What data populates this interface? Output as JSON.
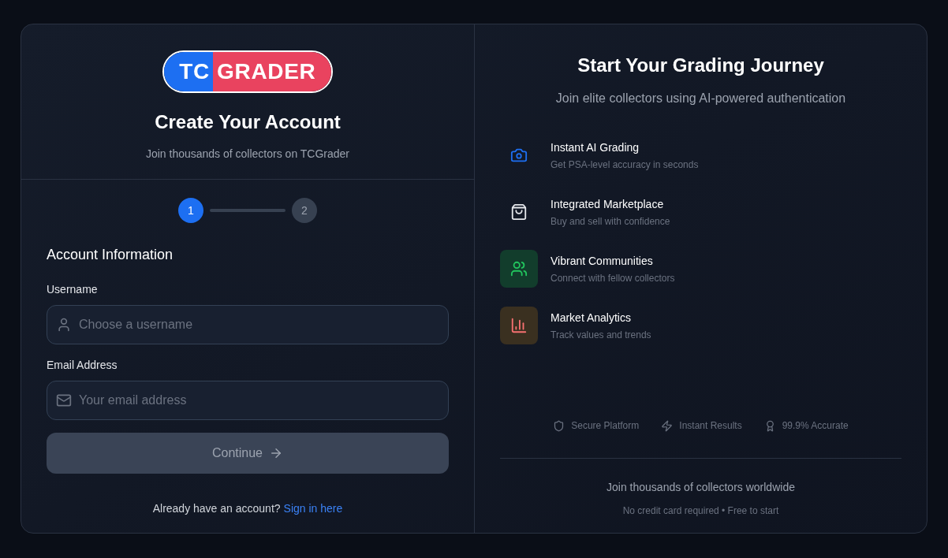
{
  "logo": {
    "left": "TC",
    "right": "GRADER"
  },
  "signup": {
    "title": "Create Your Account",
    "subtitle": "Join thousands of collectors on TCGrader"
  },
  "steps": [
    {
      "label": "1",
      "selected": true
    },
    {
      "label": "2",
      "selected": false
    }
  ],
  "form": {
    "heading": "Account Information",
    "fields": [
      {
        "kind": "user",
        "label": "Username",
        "placeholder": "Choose a username"
      },
      {
        "kind": "mail",
        "label": "Email Address",
        "placeholder": "Your email address"
      }
    ],
    "button": {
      "label": "Continue",
      "disabled": true
    },
    "signin": {
      "text": "Already have an account?",
      "link": "Sign in here"
    }
  },
  "promo": {
    "title": "Start Your Grading Journey",
    "subtitle": "Join elite collectors using AI-powered authentication"
  },
  "features": [
    {
      "kind": "camera",
      "title": "Instant AI Grading",
      "text": "Get PSA-level accuracy in seconds",
      "color": "#1d6ff2"
    },
    {
      "kind": "bag",
      "title": "Integrated Marketplace",
      "text": "Buy and sell with confidence",
      "color": "#e5e7eb"
    },
    {
      "kind": "users",
      "title": "Vibrant Communities",
      "text": "Connect with fellow collectors",
      "color": "#22c55e"
    },
    {
      "kind": "chart",
      "title": "Market Analytics",
      "text": "Track values and trends",
      "color": "#f87171"
    }
  ],
  "badges": [
    {
      "kind": "shield",
      "label": "Secure Platform"
    },
    {
      "kind": "bolt",
      "label": "Instant Results"
    },
    {
      "kind": "award",
      "label": "99.9% Accurate"
    }
  ],
  "footer": {
    "line1": "Join thousands of collectors worldwide",
    "line2": "No credit card required • Free to start"
  }
}
